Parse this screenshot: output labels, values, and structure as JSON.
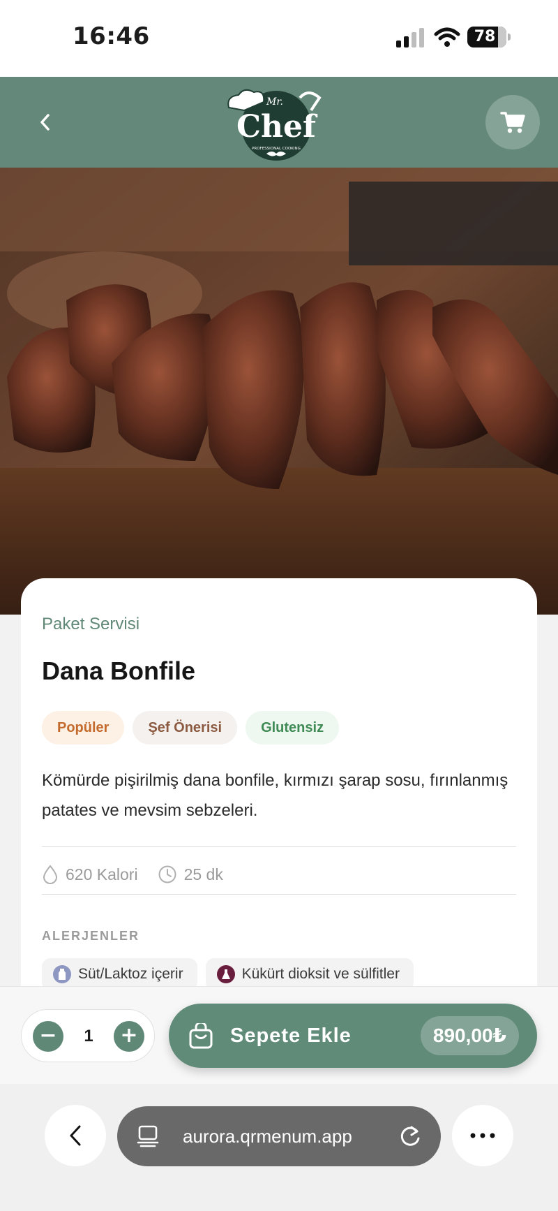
{
  "status_bar": {
    "time": "16:46",
    "battery": "78",
    "battery_level": 0.78
  },
  "header": {
    "brand_text": "Chef",
    "brand_small": "Mr.",
    "brand_tagline": "PROFESSIONAL COOKING",
    "icons": [
      "back-icon",
      "chef-hat-logo",
      "cart-icon"
    ]
  },
  "product": {
    "category": "Paket Servisi",
    "title": "Dana Bonfile",
    "tags": [
      "Popüler",
      "Şef Önerisi",
      "Glutensiz"
    ],
    "description": "Kömürde pişirilmiş dana bonfile, kırmızı şarap sosu, fırınlanmış patates ve mevsim sebzeleri.",
    "calories": "620 Kalori",
    "time": "25 dk",
    "allergens_heading": "ALERJENLER",
    "allergens": [
      "Süt/Laktoz içerir",
      "Kükürt dioksit ve sülfitler"
    ]
  },
  "cart_bar": {
    "quantity": "1",
    "minus": "−",
    "plus": "+",
    "add_label": "Sepete Ekle",
    "price": "890,00₺"
  },
  "browser": {
    "url": "aurora.qrmenum.app"
  },
  "colors": {
    "brand_green": "#64897a",
    "popular": "#c46a2d",
    "chef": "#8c5a41",
    "gluten": "#3f8a55"
  }
}
